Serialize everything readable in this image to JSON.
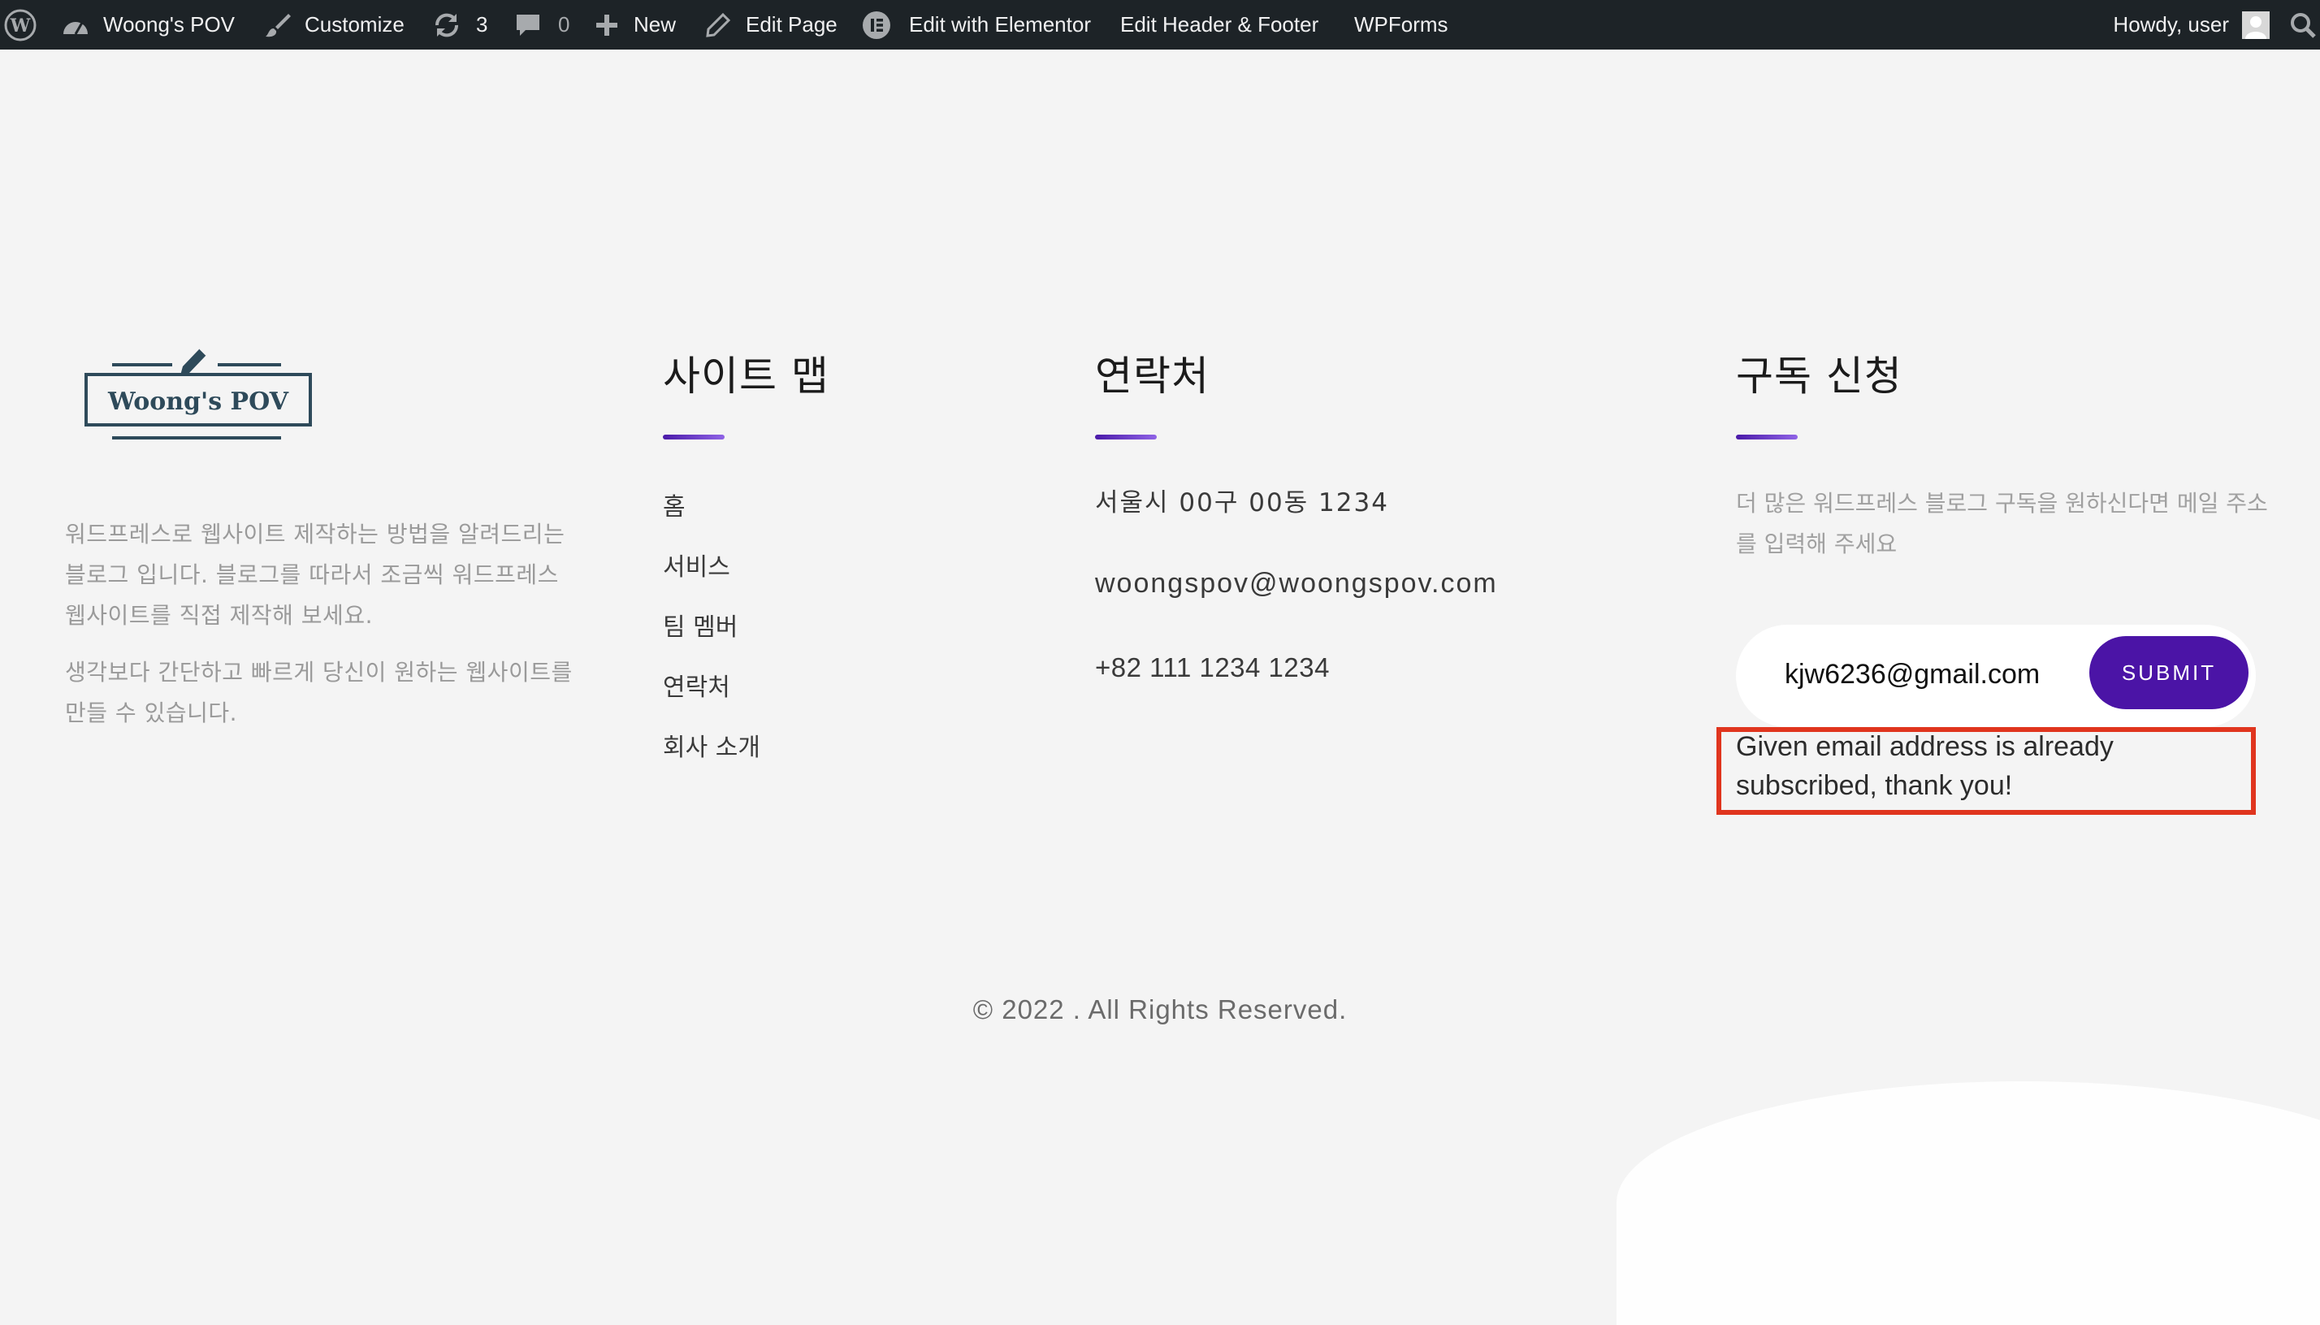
{
  "adminbar": {
    "site_name": "Woong's POV",
    "customize": "Customize",
    "updates_count": "3",
    "comments_count": "0",
    "new": "New",
    "edit_page": "Edit Page",
    "edit_elementor": "Edit with Elementor",
    "edit_header_footer": "Edit Header & Footer",
    "wpforms": "WPForms",
    "howdy": "Howdy, user"
  },
  "logo": {
    "text": "Woong's POV"
  },
  "about": {
    "paragraph1": "워드프레스로 웹사이트 제작하는 방법을 알려드리는 블로그 입니다. 블로그를 따라서 조금씩 워드프레스 웹사이트를 직접 제작해 보세요.",
    "paragraph2": "생각보다 간단하고 빠르게 당신이 원하는 웹사이트를 만들 수 있습니다."
  },
  "sitemap": {
    "heading": "사이트 맵",
    "links": [
      "홈",
      "서비스",
      "팀 멤버",
      "연락처",
      "회사 소개"
    ]
  },
  "contact": {
    "heading": "연락처",
    "address": "서울시 00구 00동 1234",
    "email": "woongspov@woongspov.com",
    "phone": "+82 111 1234 1234"
  },
  "subscribe": {
    "heading": "구독 신청",
    "description": "더 많은 워드프레스 블로그 구독을 원하신다면 메일 주소를 입력해 주세요",
    "email_value": "kjw6236@gmail.com",
    "submit_label": "SUBMIT",
    "message": "Given email address is already subscribed, thank you!"
  },
  "copyright": "© 2022 . All Rights Reserved.",
  "colors": {
    "adminbar_bg": "#1d2327",
    "submit_bg": "#4b14a6",
    "highlight_border": "#e0351e",
    "accent_start": "#4a1aa8",
    "accent_end": "#8f63e6"
  },
  "icons": {
    "wp_logo": "wordpress-icon",
    "dashboard": "dashboard-icon",
    "customize": "paintbrush-icon",
    "updates": "refresh-icon",
    "comments": "comment-icon",
    "new": "plus-icon",
    "edit": "pencil-icon",
    "elementor": "elementor-icon",
    "avatar": "avatar-icon",
    "search": "search-icon"
  }
}
